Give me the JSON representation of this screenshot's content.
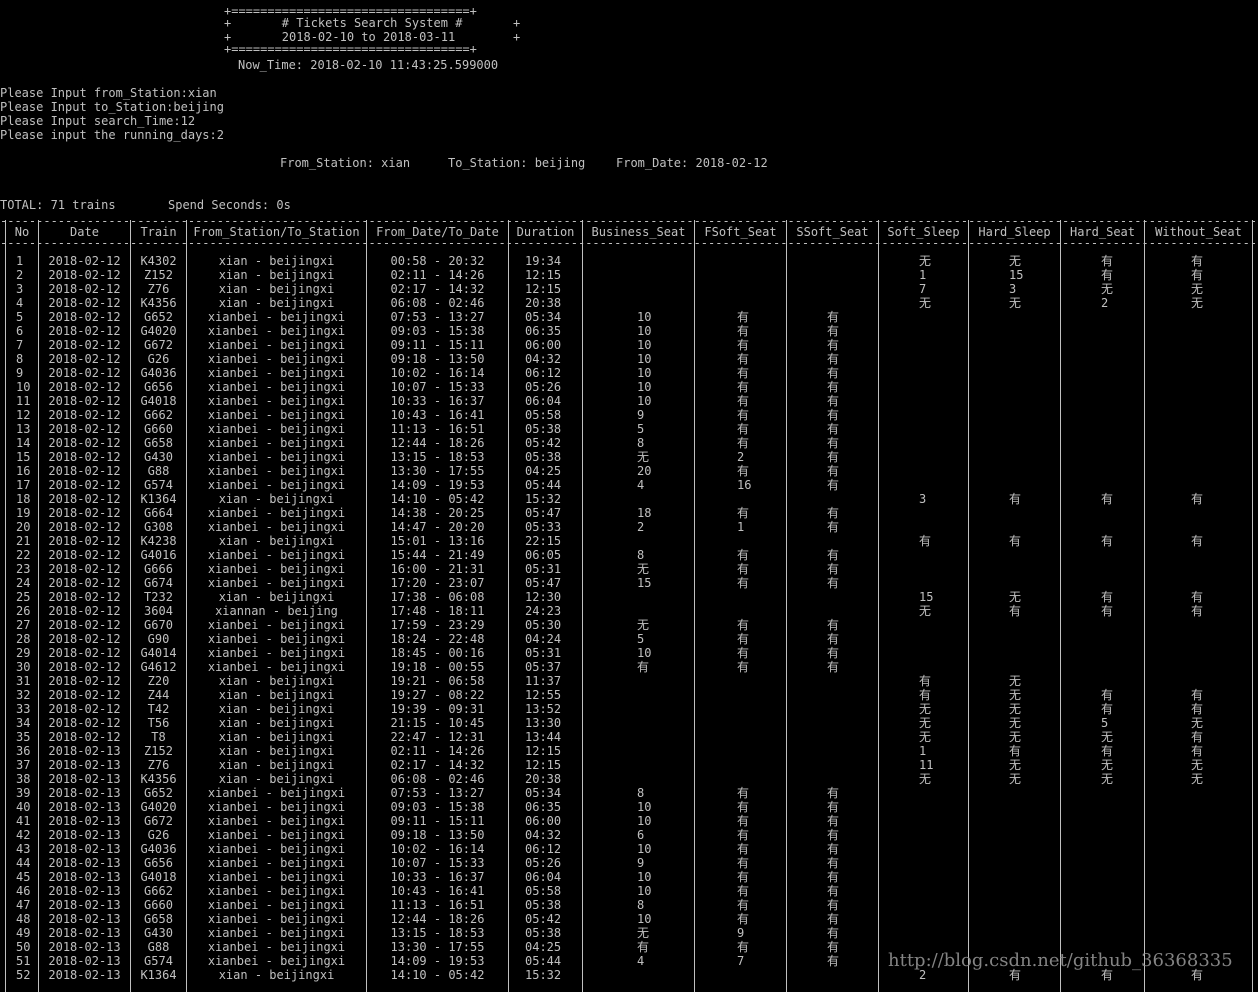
{
  "banner": {
    "top_border": "+=================================+",
    "title_line": "+       # Tickets Search System #       +",
    "range_line": "+       2018-02-10 to 2018-03-11        +",
    "bottom_border": "+=================================+",
    "now_time": "Now_Time: 2018-02-10 11:43:25.599000"
  },
  "inputs": [
    "Please Input from_Station:xian",
    "Please Input to_Station:beijing",
    "Please Input search_Time:12",
    "Please input the running_days:2"
  ],
  "query_summary": {
    "from_station": "From_Station: xian",
    "to_station": "To_Station: beijing",
    "from_date": "From_Date: 2018-02-12"
  },
  "totals": {
    "total": "TOTAL: 71 trains",
    "spend": "Spend Seconds: 0s"
  },
  "columns": [
    "No",
    "Date",
    "Train",
    "From_Station/To_Station",
    "From_Date/To_Date",
    "Duration",
    "Business_Seat",
    "FSoft_Seat",
    "SSoft_Seat",
    "Soft_Sleep",
    "Hard_Sleep",
    "Hard_Seat",
    "Without_Seat"
  ],
  "rows": [
    [
      "1",
      "2018-02-12",
      "K4302",
      "xian - beijingxi",
      "00:58 - 20:32",
      "19:34",
      "",
      "",
      "",
      "无",
      "无",
      "有",
      "有"
    ],
    [
      "2",
      "2018-02-12",
      "Z152",
      "xian - beijingxi",
      "02:11 - 14:26",
      "12:15",
      "",
      "",
      "",
      "1",
      "15",
      "有",
      "有"
    ],
    [
      "3",
      "2018-02-12",
      "Z76",
      "xian - beijingxi",
      "02:17 - 14:32",
      "12:15",
      "",
      "",
      "",
      "7",
      "3",
      "无",
      "无"
    ],
    [
      "4",
      "2018-02-12",
      "K4356",
      "xian - beijingxi",
      "06:08 - 02:46",
      "20:38",
      "",
      "",
      "",
      "无",
      "无",
      "2",
      "无"
    ],
    [
      "5",
      "2018-02-12",
      "G652",
      "xianbei - beijingxi",
      "07:53 - 13:27",
      "05:34",
      "10",
      "有",
      "有",
      "",
      "",
      "",
      ""
    ],
    [
      "6",
      "2018-02-12",
      "G4020",
      "xianbei - beijingxi",
      "09:03 - 15:38",
      "06:35",
      "10",
      "有",
      "有",
      "",
      "",
      "",
      ""
    ],
    [
      "7",
      "2018-02-12",
      "G672",
      "xianbei - beijingxi",
      "09:11 - 15:11",
      "06:00",
      "10",
      "有",
      "有",
      "",
      "",
      "",
      ""
    ],
    [
      "8",
      "2018-02-12",
      "G26",
      "xianbei - beijingxi",
      "09:18 - 13:50",
      "04:32",
      "10",
      "有",
      "有",
      "",
      "",
      "",
      ""
    ],
    [
      "9",
      "2018-02-12",
      "G4036",
      "xianbei - beijingxi",
      "10:02 - 16:14",
      "06:12",
      "10",
      "有",
      "有",
      "",
      "",
      "",
      ""
    ],
    [
      "10",
      "2018-02-12",
      "G656",
      "xianbei - beijingxi",
      "10:07 - 15:33",
      "05:26",
      "10",
      "有",
      "有",
      "",
      "",
      "",
      ""
    ],
    [
      "11",
      "2018-02-12",
      "G4018",
      "xianbei - beijingxi",
      "10:33 - 16:37",
      "06:04",
      "10",
      "有",
      "有",
      "",
      "",
      "",
      ""
    ],
    [
      "12",
      "2018-02-12",
      "G662",
      "xianbei - beijingxi",
      "10:43 - 16:41",
      "05:58",
      "9",
      "有",
      "有",
      "",
      "",
      "",
      ""
    ],
    [
      "13",
      "2018-02-12",
      "G660",
      "xianbei - beijingxi",
      "11:13 - 16:51",
      "05:38",
      "5",
      "有",
      "有",
      "",
      "",
      "",
      ""
    ],
    [
      "14",
      "2018-02-12",
      "G658",
      "xianbei - beijingxi",
      "12:44 - 18:26",
      "05:42",
      "8",
      "有",
      "有",
      "",
      "",
      "",
      ""
    ],
    [
      "15",
      "2018-02-12",
      "G430",
      "xianbei - beijingxi",
      "13:15 - 18:53",
      "05:38",
      "无",
      "2",
      "有",
      "",
      "",
      "",
      ""
    ],
    [
      "16",
      "2018-02-12",
      "G88",
      "xianbei - beijingxi",
      "13:30 - 17:55",
      "04:25",
      "20",
      "有",
      "有",
      "",
      "",
      "",
      ""
    ],
    [
      "17",
      "2018-02-12",
      "G574",
      "xianbei - beijingxi",
      "14:09 - 19:53",
      "05:44",
      "4",
      "16",
      "有",
      "",
      "",
      "",
      ""
    ],
    [
      "18",
      "2018-02-12",
      "K1364",
      "xian - beijingxi",
      "14:10 - 05:42",
      "15:32",
      "",
      "",
      "",
      "3",
      "有",
      "有",
      "有"
    ],
    [
      "19",
      "2018-02-12",
      "G664",
      "xianbei - beijingxi",
      "14:38 - 20:25",
      "05:47",
      "18",
      "有",
      "有",
      "",
      "",
      "",
      ""
    ],
    [
      "20",
      "2018-02-12",
      "G308",
      "xianbei - beijingxi",
      "14:47 - 20:20",
      "05:33",
      "2",
      "1",
      "有",
      "",
      "",
      "",
      ""
    ],
    [
      "21",
      "2018-02-12",
      "K4238",
      "xian - beijingxi",
      "15:01 - 13:16",
      "22:15",
      "",
      "",
      "",
      "有",
      "有",
      "有",
      "有"
    ],
    [
      "22",
      "2018-02-12",
      "G4016",
      "xianbei - beijingxi",
      "15:44 - 21:49",
      "06:05",
      "8",
      "有",
      "有",
      "",
      "",
      "",
      ""
    ],
    [
      "23",
      "2018-02-12",
      "G666",
      "xianbei - beijingxi",
      "16:00 - 21:31",
      "05:31",
      "无",
      "有",
      "有",
      "",
      "",
      "",
      ""
    ],
    [
      "24",
      "2018-02-12",
      "G674",
      "xianbei - beijingxi",
      "17:20 - 23:07",
      "05:47",
      "15",
      "有",
      "有",
      "",
      "",
      "",
      ""
    ],
    [
      "25",
      "2018-02-12",
      "T232",
      "xian - beijingxi",
      "17:38 - 06:08",
      "12:30",
      "",
      "",
      "",
      "15",
      "无",
      "有",
      "有"
    ],
    [
      "26",
      "2018-02-12",
      "3604",
      "xiannan - beijing",
      "17:48 - 18:11",
      "24:23",
      "",
      "",
      "",
      "无",
      "有",
      "有",
      "有"
    ],
    [
      "27",
      "2018-02-12",
      "G670",
      "xianbei - beijingxi",
      "17:59 - 23:29",
      "05:30",
      "无",
      "有",
      "有",
      "",
      "",
      "",
      ""
    ],
    [
      "28",
      "2018-02-12",
      "G90",
      "xianbei - beijingxi",
      "18:24 - 22:48",
      "04:24",
      "5",
      "有",
      "有",
      "",
      "",
      "",
      ""
    ],
    [
      "29",
      "2018-02-12",
      "G4014",
      "xianbei - beijingxi",
      "18:45 - 00:16",
      "05:31",
      "10",
      "有",
      "有",
      "",
      "",
      "",
      ""
    ],
    [
      "30",
      "2018-02-12",
      "G4612",
      "xianbei - beijingxi",
      "19:18 - 00:55",
      "05:37",
      "有",
      "有",
      "有",
      "",
      "",
      "",
      ""
    ],
    [
      "31",
      "2018-02-12",
      "Z20",
      "xian - beijingxi",
      "19:21 - 06:58",
      "11:37",
      "",
      "",
      "",
      "有",
      "无",
      "",
      ""
    ],
    [
      "32",
      "2018-02-12",
      "Z44",
      "xian - beijingxi",
      "19:27 - 08:22",
      "12:55",
      "",
      "",
      "",
      "有",
      "无",
      "有",
      "有"
    ],
    [
      "33",
      "2018-02-12",
      "T42",
      "xian - beijingxi",
      "19:39 - 09:31",
      "13:52",
      "",
      "",
      "",
      "无",
      "无",
      "有",
      "有"
    ],
    [
      "34",
      "2018-02-12",
      "T56",
      "xian - beijingxi",
      "21:15 - 10:45",
      "13:30",
      "",
      "",
      "",
      "无",
      "无",
      "5",
      "无"
    ],
    [
      "35",
      "2018-02-12",
      "T8",
      "xian - beijingxi",
      "22:47 - 12:31",
      "13:44",
      "",
      "",
      "",
      "无",
      "无",
      "无",
      "有"
    ],
    [
      "36",
      "2018-02-13",
      "Z152",
      "xian - beijingxi",
      "02:11 - 14:26",
      "12:15",
      "",
      "",
      "",
      "1",
      "有",
      "有",
      "有"
    ],
    [
      "37",
      "2018-02-13",
      "Z76",
      "xian - beijingxi",
      "02:17 - 14:32",
      "12:15",
      "",
      "",
      "",
      "11",
      "无",
      "无",
      "无"
    ],
    [
      "38",
      "2018-02-13",
      "K4356",
      "xian - beijingxi",
      "06:08 - 02:46",
      "20:38",
      "",
      "",
      "",
      "无",
      "无",
      "无",
      "无"
    ],
    [
      "39",
      "2018-02-13",
      "G652",
      "xianbei - beijingxi",
      "07:53 - 13:27",
      "05:34",
      "8",
      "有",
      "有",
      "",
      "",
      "",
      ""
    ],
    [
      "40",
      "2018-02-13",
      "G4020",
      "xianbei - beijingxi",
      "09:03 - 15:38",
      "06:35",
      "10",
      "有",
      "有",
      "",
      "",
      "",
      ""
    ],
    [
      "41",
      "2018-02-13",
      "G672",
      "xianbei - beijingxi",
      "09:11 - 15:11",
      "06:00",
      "10",
      "有",
      "有",
      "",
      "",
      "",
      ""
    ],
    [
      "42",
      "2018-02-13",
      "G26",
      "xianbei - beijingxi",
      "09:18 - 13:50",
      "04:32",
      "6",
      "有",
      "有",
      "",
      "",
      "",
      ""
    ],
    [
      "43",
      "2018-02-13",
      "G4036",
      "xianbei - beijingxi",
      "10:02 - 16:14",
      "06:12",
      "10",
      "有",
      "有",
      "",
      "",
      "",
      ""
    ],
    [
      "44",
      "2018-02-13",
      "G656",
      "xianbei - beijingxi",
      "10:07 - 15:33",
      "05:26",
      "9",
      "有",
      "有",
      "",
      "",
      "",
      ""
    ],
    [
      "45",
      "2018-02-13",
      "G4018",
      "xianbei - beijingxi",
      "10:33 - 16:37",
      "06:04",
      "10",
      "有",
      "有",
      "",
      "",
      "",
      ""
    ],
    [
      "46",
      "2018-02-13",
      "G662",
      "xianbei - beijingxi",
      "10:43 - 16:41",
      "05:58",
      "10",
      "有",
      "有",
      "",
      "",
      "",
      ""
    ],
    [
      "47",
      "2018-02-13",
      "G660",
      "xianbei - beijingxi",
      "11:13 - 16:51",
      "05:38",
      "8",
      "有",
      "有",
      "",
      "",
      "",
      ""
    ],
    [
      "48",
      "2018-02-13",
      "G658",
      "xianbei - beijingxi",
      "12:44 - 18:26",
      "05:42",
      "10",
      "有",
      "有",
      "",
      "",
      "",
      ""
    ],
    [
      "49",
      "2018-02-13",
      "G430",
      "xianbei - beijingxi",
      "13:15 - 18:53",
      "05:38",
      "无",
      "9",
      "有",
      "",
      "",
      "",
      ""
    ],
    [
      "50",
      "2018-02-13",
      "G88",
      "xianbei - beijingxi",
      "13:30 - 17:55",
      "04:25",
      "有",
      "有",
      "有",
      "",
      "",
      "",
      ""
    ],
    [
      "51",
      "2018-02-13",
      "G574",
      "xianbei - beijingxi",
      "14:09 - 19:53",
      "05:44",
      "4",
      "7",
      "有",
      "",
      "",
      "",
      ""
    ],
    [
      "52",
      "2018-02-13",
      "K1364",
      "xian - beijingxi",
      "14:10 - 05:42",
      "15:32",
      "",
      "",
      "",
      "2",
      "有",
      "有",
      "有"
    ]
  ],
  "watermark": "http://blog.csdn.net/github_36368335",
  "colors": {
    "background": "#000000",
    "text": "#c0c0c0"
  }
}
